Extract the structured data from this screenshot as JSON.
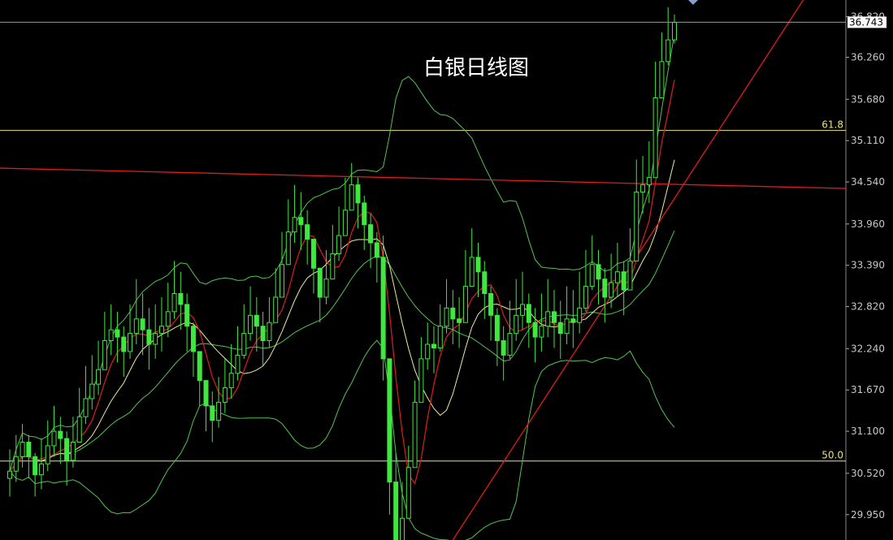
{
  "chart_data": {
    "type": "candlestick",
    "title": "白银日线图",
    "ylim": [
      29.6,
      37.05
    ],
    "yticks": [
      "36.820",
      "36.260",
      "35.680",
      "35.110",
      "34.540",
      "33.960",
      "33.390",
      "32.820",
      "32.240",
      "31.670",
      "31.100",
      "30.520",
      "29.950"
    ],
    "current_price": "36.743",
    "fib_levels": [
      {
        "label": "61.8",
        "value": 35.25
      },
      {
        "label": "50.0",
        "value": 30.69
      }
    ],
    "resistance_line": {
      "from": 34.73,
      "to": 34.45
    },
    "trendline": {
      "from_index": 70,
      "from_value": 29.6,
      "to_index": 122,
      "to_value": 36.6
    },
    "colors": {
      "candle": "#3ee83e",
      "ma_fast": "#e01c1c",
      "ma_slow": "#ecec9e",
      "bollinger": "#52c452",
      "fib_line": "#e8e27a",
      "resistance": "#e01c1c",
      "trendline": "#e01c1c",
      "price_tag_bg": "#ffffff"
    },
    "closes": [
      30.55,
      30.75,
      30.95,
      30.75,
      30.5,
      30.65,
      30.9,
      31.1,
      31.0,
      30.7,
      30.95,
      31.3,
      31.55,
      31.75,
      31.95,
      32.35,
      32.5,
      32.4,
      32.2,
      32.45,
      32.65,
      32.5,
      32.3,
      32.45,
      32.55,
      32.75,
      33.0,
      32.85,
      32.55,
      32.2,
      31.8,
      31.45,
      31.25,
      31.5,
      31.7,
      31.9,
      32.15,
      32.45,
      32.7,
      32.55,
      32.35,
      32.6,
      32.95,
      33.4,
      33.85,
      34.05,
      33.95,
      33.75,
      33.35,
      32.95,
      33.2,
      33.55,
      33.8,
      34.15,
      34.5,
      34.25,
      33.95,
      33.7,
      33.5,
      32.1,
      30.4,
      29.5,
      29.9,
      30.6,
      31.5,
      32.1,
      32.3,
      32.25,
      32.55,
      32.8,
      32.65,
      32.6,
      33.1,
      33.5,
      33.3,
      33.0,
      32.7,
      32.35,
      32.15,
      32.45,
      32.7,
      32.85,
      32.6,
      32.4,
      32.55,
      32.75,
      32.6,
      32.45,
      32.65,
      32.6,
      32.8,
      33.1,
      33.4,
      33.2,
      32.95,
      33.15,
      33.3,
      33.05,
      33.45,
      34.4,
      34.5,
      34.6,
      35.7,
      36.2,
      36.5,
      36.74
    ],
    "highs": [
      30.85,
      31.05,
      31.2,
      31.05,
      30.8,
      31.0,
      31.25,
      31.45,
      31.3,
      31.1,
      31.3,
      31.7,
      32.0,
      32.15,
      32.35,
      32.75,
      32.85,
      32.75,
      32.55,
      32.85,
      33.2,
      33.0,
      32.8,
      32.85,
      32.95,
      33.15,
      33.45,
      33.3,
      33.0,
      32.6,
      32.2,
      31.8,
      31.65,
      31.85,
      32.1,
      32.3,
      32.55,
      32.85,
      33.1,
      32.95,
      32.75,
      32.95,
      33.35,
      33.85,
      34.3,
      34.5,
      34.4,
      34.15,
      33.75,
      33.35,
      33.6,
      33.95,
      34.2,
      34.6,
      34.8,
      34.6,
      34.35,
      34.1,
      33.85,
      33.8,
      31.5,
      30.8,
      30.4,
      30.9,
      31.8,
      32.4,
      32.6,
      32.55,
      32.85,
      33.2,
      33.05,
      32.95,
      33.6,
      33.9,
      33.7,
      33.45,
      33.1,
      32.8,
      32.55,
      32.9,
      33.2,
      33.3,
      33.0,
      32.8,
      33.0,
      33.2,
      33.05,
      32.9,
      33.1,
      33.05,
      33.3,
      33.6,
      33.8,
      33.6,
      33.35,
      33.55,
      33.7,
      33.45,
      33.9,
      34.85,
      34.9,
      35.1,
      36.2,
      36.6,
      36.95,
      36.85
    ],
    "lows": [
      30.2,
      30.4,
      30.6,
      30.45,
      30.2,
      30.3,
      30.55,
      30.75,
      30.65,
      30.35,
      30.6,
      30.95,
      31.2,
      31.4,
      31.6,
      32.0,
      32.15,
      32.05,
      31.85,
      32.1,
      32.3,
      32.15,
      31.95,
      32.1,
      32.2,
      32.4,
      32.65,
      32.5,
      32.2,
      31.85,
      31.45,
      31.1,
      30.95,
      31.15,
      31.35,
      31.55,
      31.8,
      32.1,
      32.35,
      32.2,
      32.0,
      32.25,
      32.6,
      33.05,
      33.5,
      33.7,
      33.6,
      33.4,
      33.0,
      32.6,
      32.85,
      33.2,
      33.45,
      33.8,
      34.15,
      33.9,
      33.6,
      33.35,
      33.15,
      31.8,
      29.95,
      29.3,
      29.5,
      30.2,
      31.1,
      31.75,
      31.95,
      31.9,
      32.2,
      32.45,
      32.3,
      32.25,
      32.75,
      33.15,
      32.95,
      32.65,
      32.35,
      32.0,
      31.8,
      32.1,
      32.35,
      32.5,
      32.25,
      32.05,
      32.2,
      32.4,
      32.25,
      32.1,
      32.3,
      32.25,
      32.45,
      32.75,
      33.05,
      32.85,
      32.6,
      32.8,
      32.95,
      32.7,
      33.1,
      34.0,
      34.1,
      34.25,
      35.3,
      35.8,
      36.15,
      36.45
    ]
  }
}
